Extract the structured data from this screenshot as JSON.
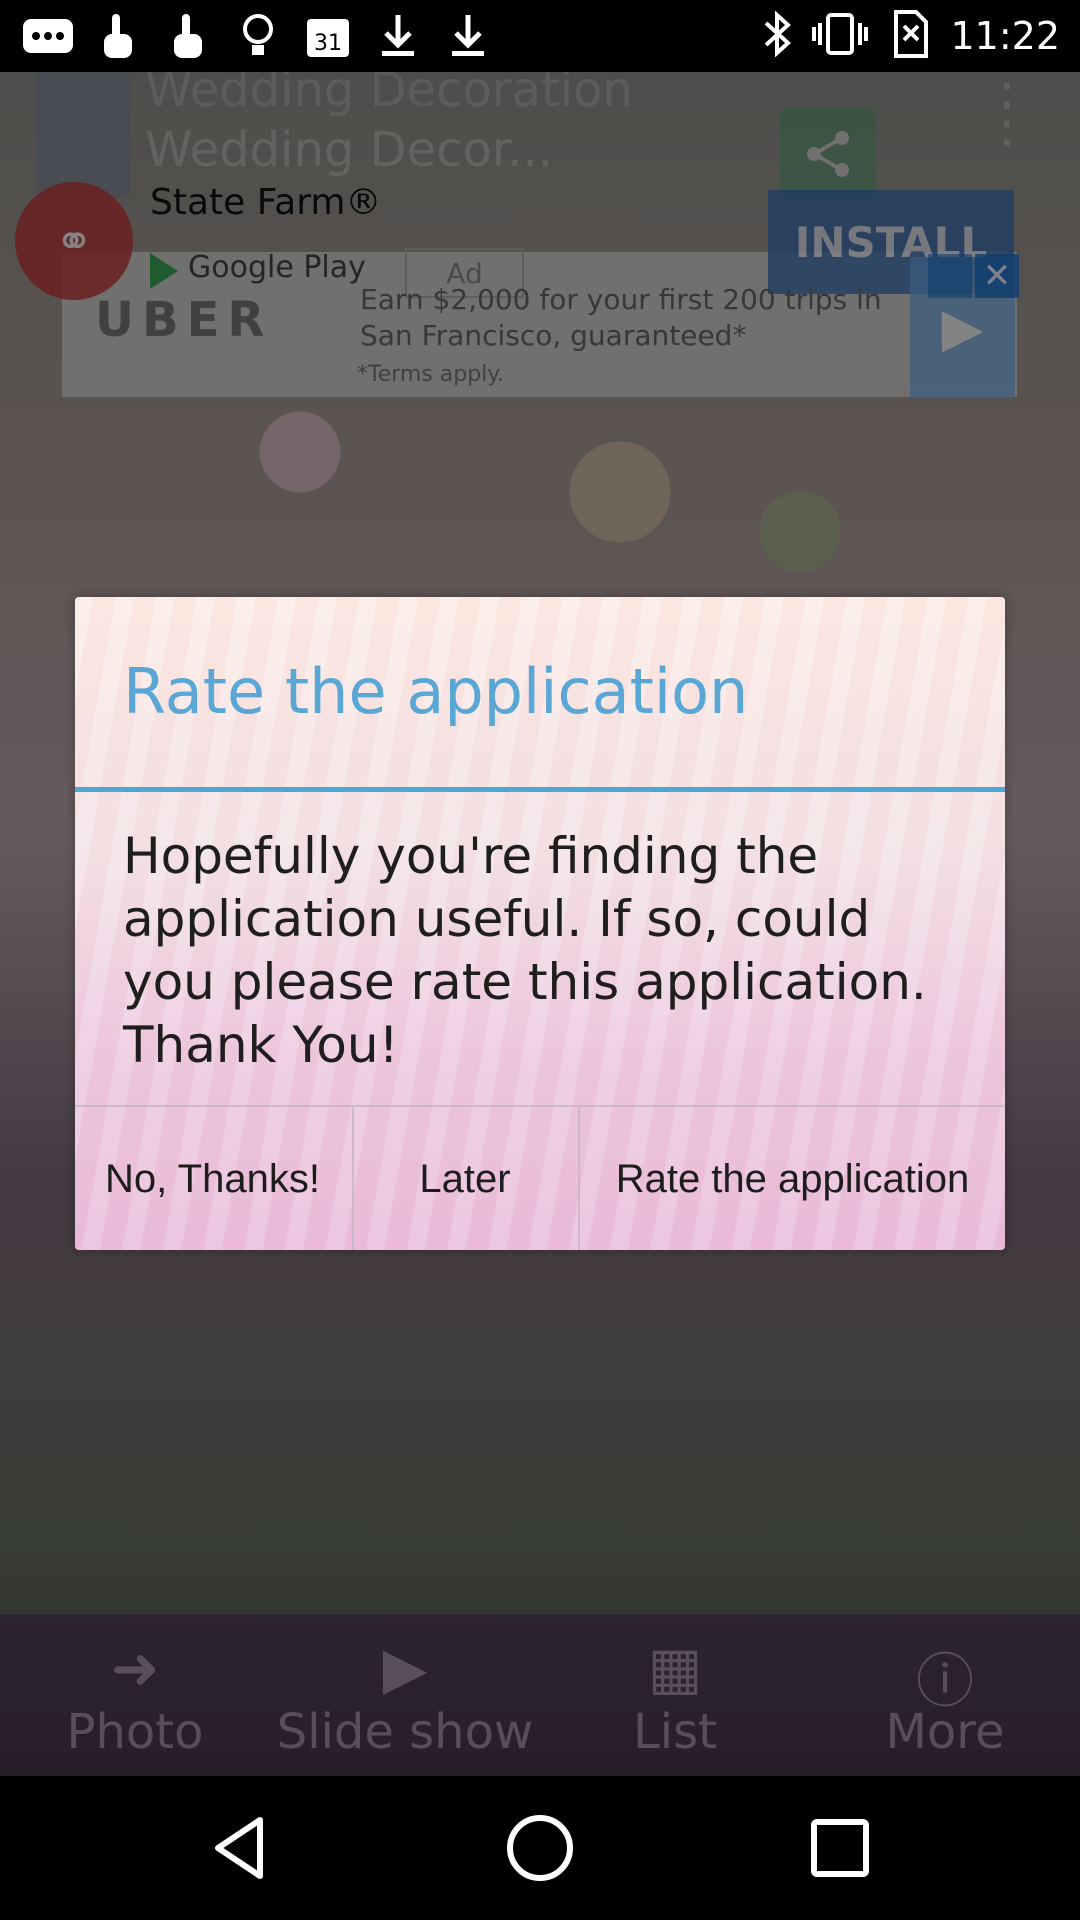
{
  "status_bar": {
    "icons": [
      "more-icon",
      "touch-icon",
      "touch-icon",
      "bulb-icon",
      "calendar-icon",
      "download-icon",
      "download-icon"
    ],
    "calendar_day": "31",
    "right_icons": [
      "bluetooth-icon",
      "vibrate-icon",
      "no-sim-icon"
    ],
    "time": "11:22"
  },
  "app_bar": {
    "title": "Wedding Decor...",
    "title_behind": "Wedding Decoration"
  },
  "ad": {
    "advertiser": "State Farm®",
    "install_label": "INSTALL",
    "store_label": "Google Play",
    "ad_badge": "Ad",
    "uber_logo": "UBER",
    "uber_message": "Earn $2,000 for your first 200 trips in San Francisco, guaranteed*",
    "uber_terms": "*Terms apply."
  },
  "bottom_nav": {
    "items": [
      {
        "label": "Photo",
        "icon": "arrow-right-icon"
      },
      {
        "label": "Slide show",
        "icon": "play-icon"
      },
      {
        "label": "List",
        "icon": "grid-icon"
      },
      {
        "label": "More",
        "icon": "info-icon"
      }
    ]
  },
  "dialog": {
    "title": "Rate the application",
    "message": "Hopefully you're finding the application useful. If so, could you please rate this application. Thank You!",
    "buttons": {
      "no": "No, Thanks!",
      "later": "Later",
      "rate": "Rate the application"
    }
  },
  "colors": {
    "accent": "#4aa7d6",
    "title_color": "#5aa7d6"
  }
}
